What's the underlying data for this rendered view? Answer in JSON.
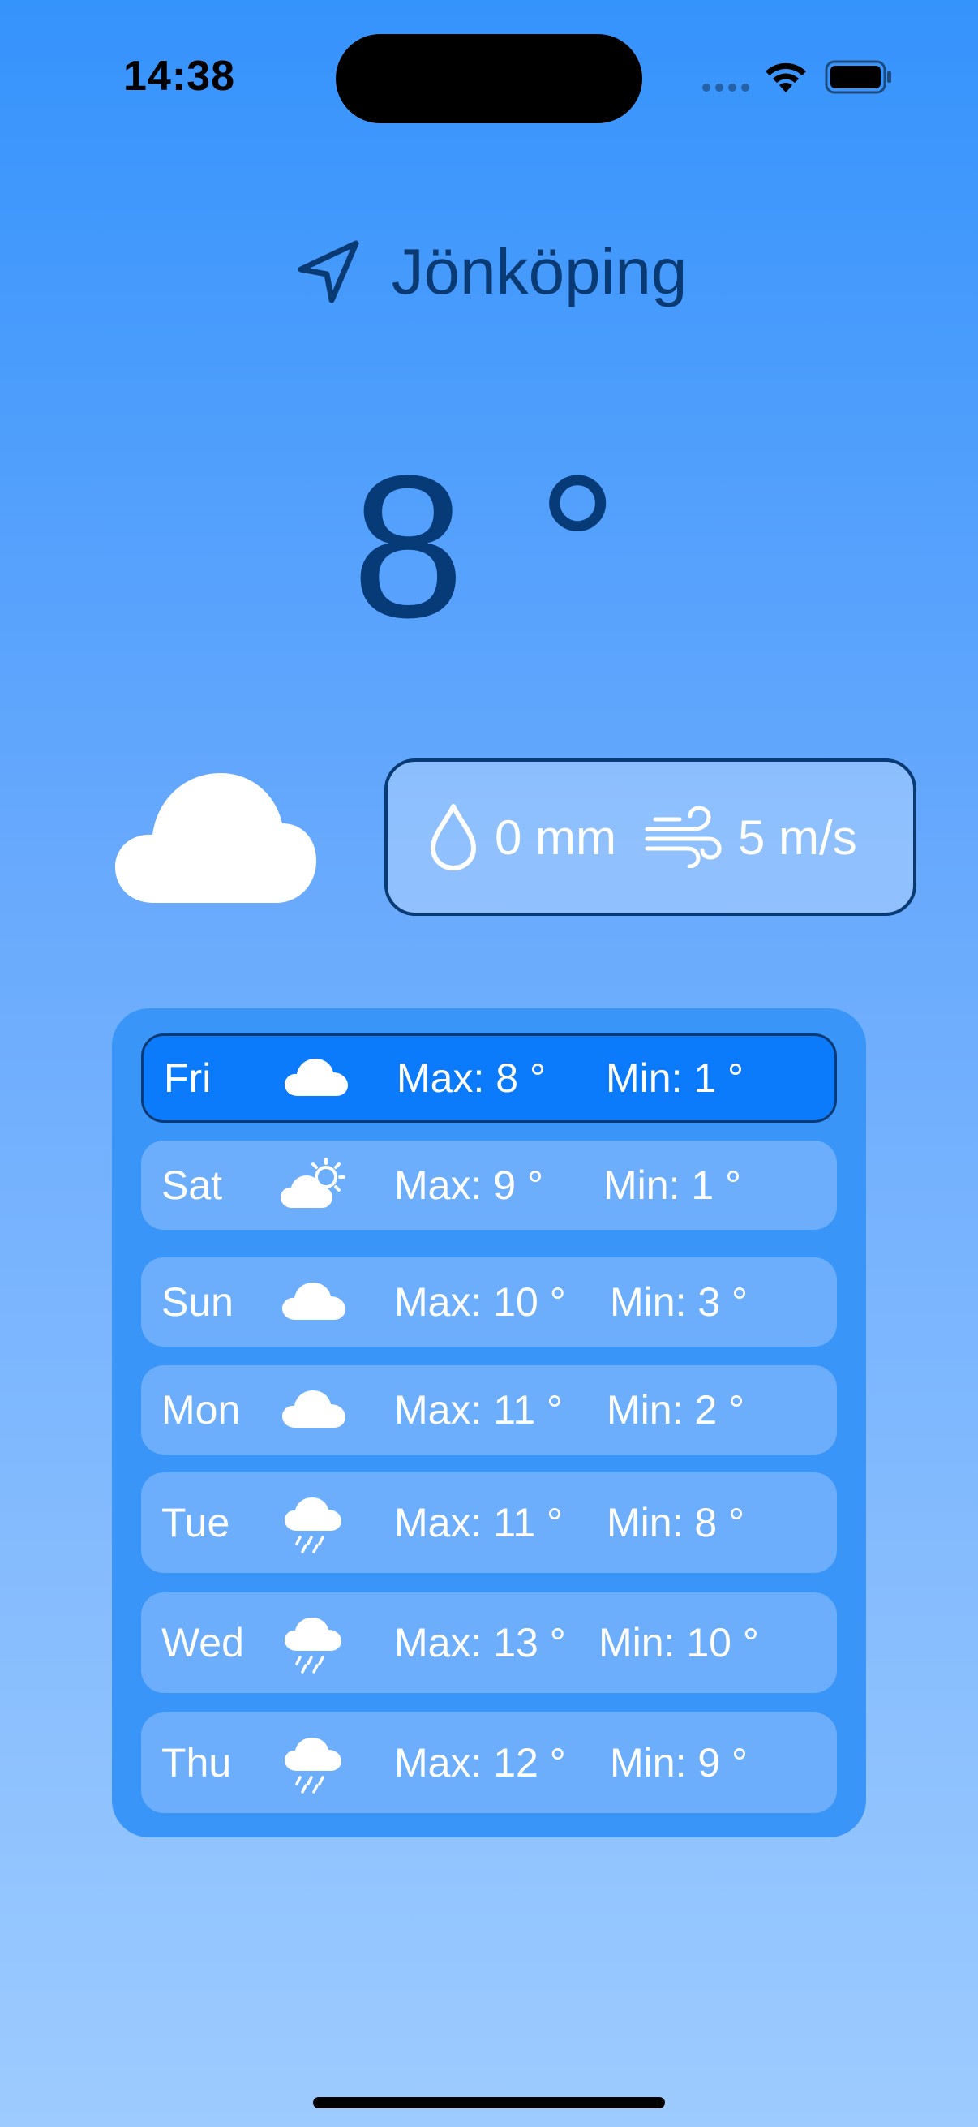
{
  "status_bar": {
    "time": "14:38"
  },
  "location": {
    "city": "Jönköping",
    "icon": "location-arrow-icon"
  },
  "current": {
    "temperature": "8 °",
    "condition_icon": "cloud-icon",
    "precipitation": "0 mm",
    "precipitation_icon": "droplet-icon",
    "wind": "5 m/s",
    "wind_icon": "wind-icon"
  },
  "forecast": [
    {
      "day": "Fri",
      "icon": "cloud-icon",
      "max": "Max: 8 °",
      "min": "Min: 1 °",
      "selected": true
    },
    {
      "day": "Sat",
      "icon": "partly-sunny-icon",
      "max": "Max: 9 °",
      "min": "Min: 1 °",
      "selected": false
    },
    {
      "day": "Sun",
      "icon": "cloud-icon",
      "max": "Max: 10 °",
      "min": "Min: 3 °",
      "selected": false
    },
    {
      "day": "Mon",
      "icon": "cloud-icon",
      "max": "Max: 11 °",
      "min": "Min: 2 °",
      "selected": false
    },
    {
      "day": "Tue",
      "icon": "cloud-rain-icon",
      "max": "Max: 11 °",
      "min": "Min: 8 °",
      "selected": false
    },
    {
      "day": "Wed",
      "icon": "cloud-rain-icon",
      "max": "Max: 13 °",
      "min": "Min: 10 °",
      "selected": false
    },
    {
      "day": "Thu",
      "icon": "cloud-rain-icon",
      "max": "Max: 12 °",
      "min": "Min: 9 °",
      "selected": false
    }
  ],
  "colors": {
    "background_top": "#3593fc",
    "background_bottom": "#9dcbff",
    "accent_dark": "#0a3a73",
    "selected_row": "#0b7bfc",
    "panel": "#3a95f9"
  }
}
